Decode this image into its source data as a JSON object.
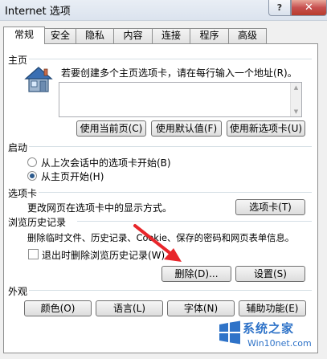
{
  "window": {
    "title": "Internet 选项",
    "help_label": "?",
    "close_label": "✕"
  },
  "tabs": [
    {
      "label": "常规",
      "active": true
    },
    {
      "label": "安全"
    },
    {
      "label": "隐私"
    },
    {
      "label": "内容"
    },
    {
      "label": "连接"
    },
    {
      "label": "程序"
    },
    {
      "label": "高级"
    }
  ],
  "homepage": {
    "group_label": "主页",
    "instructions": "若要创建多个主页选项卡，请在每行输入一个地址(R)。",
    "url_value": "",
    "use_current_label": "使用当前页(C)",
    "use_default_label": "使用默认值(F)",
    "use_new_tab_label": "使用新选项卡(U)"
  },
  "startup": {
    "group_label": "启动",
    "option_last_session": "从上次会话中的选项卡开始(B)",
    "option_homepage": "从主页开始(H)",
    "selected": "homepage"
  },
  "tabs_section": {
    "group_label": "选项卡",
    "description": "更改网页在选项卡中的显示方式。",
    "button_label": "选项卡(T)"
  },
  "history": {
    "group_label": "浏览历史记录",
    "description": "删除临时文件、历史记录、Cookie、保存的密码和网页表单信息。",
    "delete_on_exit_label": "退出时删除浏览历史记录(W)",
    "delete_on_exit_checked": false,
    "delete_button": "删除(D)...",
    "settings_button": "设置(S)"
  },
  "appearance": {
    "group_label": "外观",
    "colors_button": "颜色(O)",
    "languages_button": "语言(L)",
    "fonts_button": "字体(N)",
    "accessibility_button": "辅助功能(E)"
  },
  "watermark": {
    "brand": "系统之家",
    "url": "Win10net.com"
  },
  "colors": {
    "accent": "#2c5a8c",
    "close_red": "#c75050",
    "annotation_arrow": "#e8262b",
    "watermark_blue": "#2f73c8"
  }
}
